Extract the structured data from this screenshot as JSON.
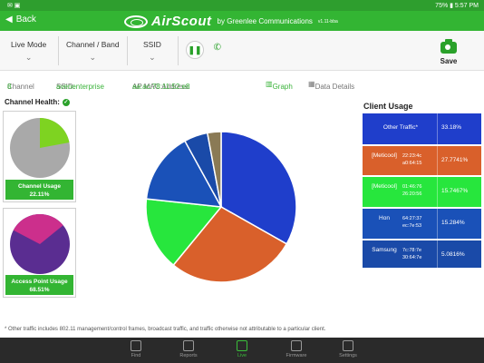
{
  "statusbar": {
    "left_icons": "✉ ▣",
    "right": "75% ▮ 5:57 PM"
  },
  "appbar": {
    "back_label": "Back",
    "app_name": "AirScout",
    "by": "by Greenlee Communications",
    "version": "v1.11-bba"
  },
  "toolbar": {
    "live_mode": "Live Mode",
    "channel_band": "Channel / Band",
    "ssid": "SSID",
    "save_label": "Save"
  },
  "info": {
    "channel_label": "Channel",
    "channel_value": "8",
    "ssid_label": "SSID:",
    "ssid_value": "avenenterprise",
    "mac_label": "AP MAC Address:",
    "mac_value": "aa:ac:78:11:52:e8",
    "graph_label": "Graph",
    "details_label": "Data Details"
  },
  "health": {
    "title": "Channel Health:",
    "channel_usage_label": "Channel Usage",
    "channel_usage_value": "22.11%",
    "ap_usage_label": "Access Point Usage",
    "ap_usage_value": "68.51%",
    "colors": {
      "channel_used": "#7ed321",
      "channel_free": "#a9a9a9",
      "ap_main": "#5a2d91",
      "ap_slice": "#cc2f8c"
    }
  },
  "chart_data": {
    "type": "pie",
    "title": "",
    "slices": [
      {
        "label": "Other Traffic*",
        "value": 33.18,
        "color": "#1f3ecb"
      },
      {
        "label": "[Meticool]",
        "value": 27.7741,
        "color": "#d9602b"
      },
      {
        "label": "[Meticool]",
        "value": 15.7467,
        "color": "#27e63d"
      },
      {
        "label": "Hon",
        "value": 15.284,
        "color": "#1a51b8"
      },
      {
        "label": "Samsung",
        "value": 5.0816,
        "color": "#1a4aa8"
      },
      {
        "label": "",
        "value": 2.9336,
        "color": "#8a7a55"
      }
    ]
  },
  "client_usage": {
    "title": "Client Usage",
    "rows": [
      {
        "name": "Other Traffic*",
        "mac": "",
        "value": "33.18%",
        "color": "#1f3ecb"
      },
      {
        "name": "[Meticool]",
        "mac": "22:23:4c a0:64:15",
        "value": "27.7741%",
        "color": "#d9602b"
      },
      {
        "name": "[Meticool]",
        "mac": "01:46:76 26:20:56",
        "value": "15.7467%",
        "color": "#27e63d"
      },
      {
        "name": "Hon",
        "mac": "64:27:37 ec:7e:53",
        "value": "15.284%",
        "color": "#1a51b8"
      },
      {
        "name": "Samsung",
        "mac": "7c:78:7e 30:64:7e",
        "value": "5.0816%",
        "color": "#1a4aa8"
      }
    ]
  },
  "footnote": "* Other traffic includes 802.11 management/control frames, broadcast traffic, and traffic otherwise not attributable to a particular client.",
  "nav": [
    {
      "label": "Find",
      "active": false
    },
    {
      "label": "Reports",
      "active": false
    },
    {
      "label": "Live",
      "active": true
    },
    {
      "label": "Firmware",
      "active": false
    },
    {
      "label": "Settings",
      "active": false
    }
  ]
}
